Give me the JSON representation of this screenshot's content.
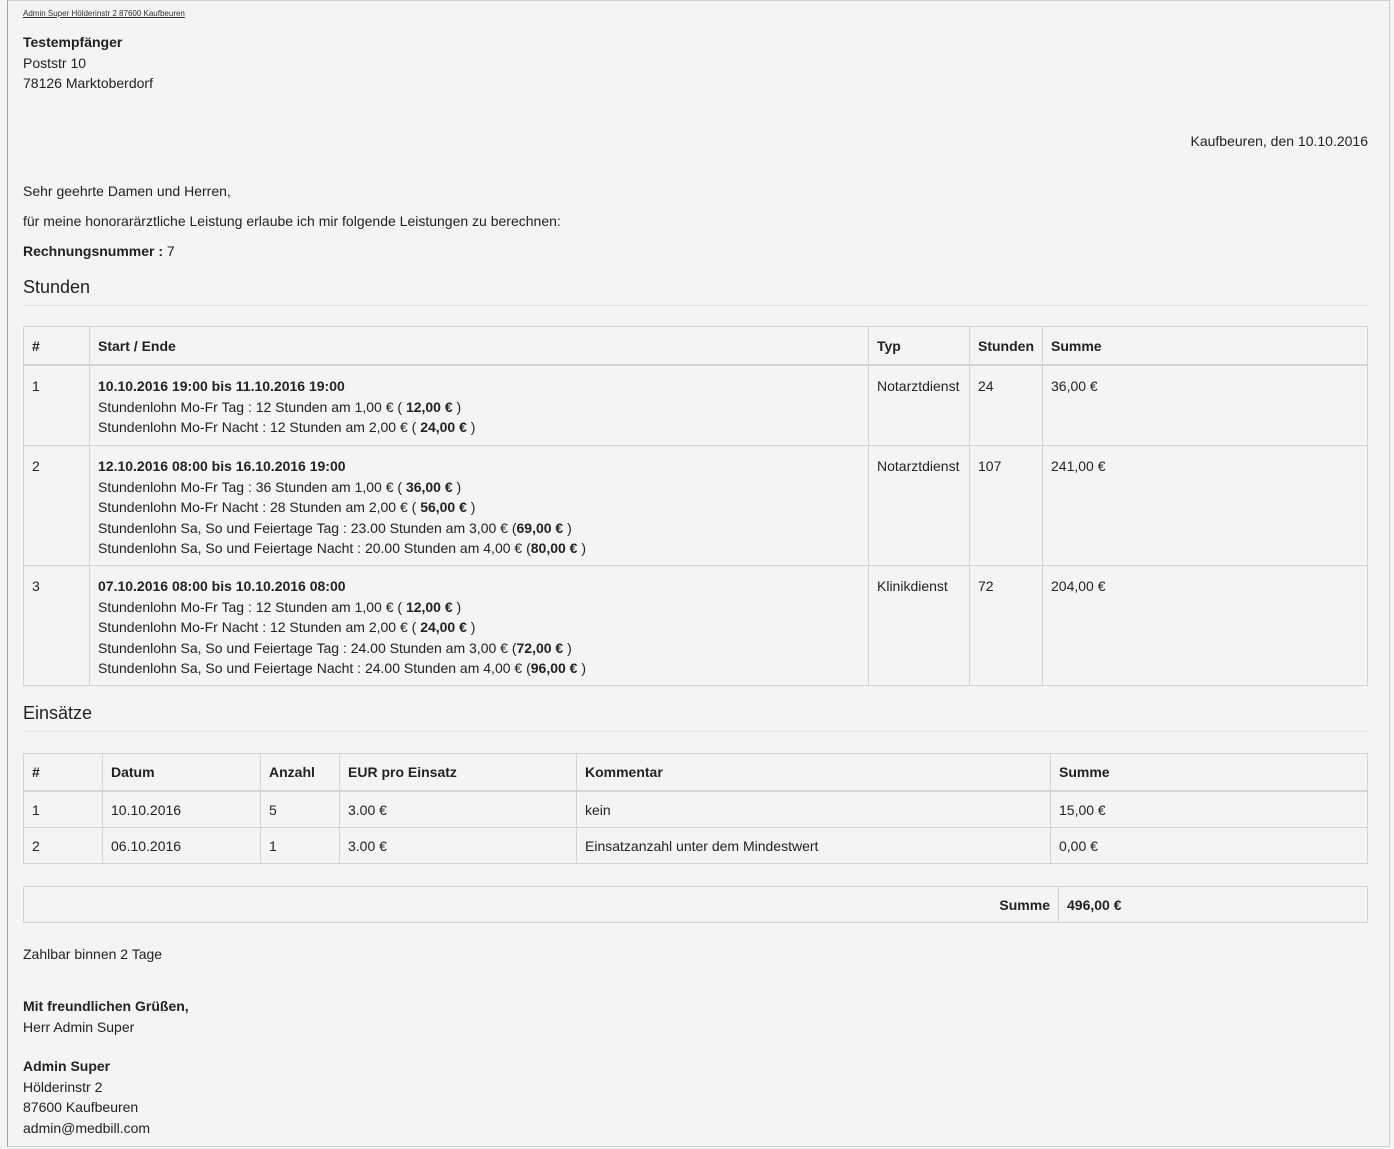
{
  "sender_line": "Admin Super Hölderinstr 2 87600 Kaufbeuren",
  "recipient": {
    "name": "Testempfänger",
    "street": "Poststr 10",
    "city": "78126 Marktoberdorf"
  },
  "date_line": "Kaufbeuren, den 10.10.2016",
  "salutation": "Sehr geehrte Damen und Herren,",
  "intro": "für meine honorarärztliche Leistung erlaube ich mir folgende Leistungen zu berechnen:",
  "invoice_number": {
    "label": "Rechnungsnummer :",
    "value": "7"
  },
  "stunden": {
    "heading": "Stunden",
    "headers": [
      "#",
      "Start / Ende",
      "Typ",
      "Stunden",
      "Summe"
    ],
    "rows": [
      {
        "num": "1",
        "period": "10.10.2016 19:00 bis 11.10.2016 19:00",
        "lines": [
          {
            "text": "Stundenlohn Mo-Fr Tag : 12 Stunden am 1,00 € ( ",
            "amount": "12,00 €",
            "close": " )"
          },
          {
            "text": "Stundenlohn Mo-Fr Nacht : 12 Stunden am 2,00 € ( ",
            "amount": "24,00 €",
            "close": " )"
          }
        ],
        "typ": "Notarztdienst",
        "stunden": "24",
        "summe": "36,00 €"
      },
      {
        "num": "2",
        "period": "12.10.2016 08:00 bis 16.10.2016 19:00",
        "lines": [
          {
            "text": "Stundenlohn Mo-Fr Tag : 36 Stunden am 1,00 € ( ",
            "amount": "36,00 €",
            "close": " )"
          },
          {
            "text": "Stundenlohn Mo-Fr Nacht : 28 Stunden am 2,00 € ( ",
            "amount": "56,00 €",
            "close": " )"
          },
          {
            "text": "Stundenlohn Sa, So und Feiertage Tag : 23.00 Stunden am 3,00 € (",
            "amount": "69,00 €",
            "close": " )"
          },
          {
            "text": "Stundenlohn Sa, So und Feiertage Nacht : 20.00 Stunden am 4,00 € (",
            "amount": "80,00 €",
            "close": " )"
          }
        ],
        "typ": "Notarztdienst",
        "stunden": "107",
        "summe": "241,00 €"
      },
      {
        "num": "3",
        "period": "07.10.2016 08:00 bis 10.10.2016 08:00",
        "lines": [
          {
            "text": "Stundenlohn Mo-Fr Tag : 12 Stunden am 1,00 € ( ",
            "amount": "12,00 €",
            "close": " )"
          },
          {
            "text": "Stundenlohn Mo-Fr Nacht : 12 Stunden am 2,00 € ( ",
            "amount": "24,00 €",
            "close": " )"
          },
          {
            "text": "Stundenlohn Sa, So und Feiertage Tag : 24.00 Stunden am 3,00 € (",
            "amount": "72,00 €",
            "close": " )"
          },
          {
            "text": "Stundenlohn Sa, So und Feiertage Nacht : 24.00 Stunden am 4,00 € (",
            "amount": "96,00 €",
            "close": " )"
          }
        ],
        "typ": "Klinikdienst",
        "stunden": "72",
        "summe": "204,00 €"
      }
    ]
  },
  "einsaetze": {
    "heading": "Einsätze",
    "headers": [
      "#",
      "Datum",
      "Anzahl",
      "EUR pro Einsatz",
      "Kommentar",
      "Summe"
    ],
    "rows": [
      {
        "num": "1",
        "datum": "10.10.2016",
        "anzahl": "5",
        "eur": "3.00 €",
        "kommentar": "kein",
        "summe": "15,00 €"
      },
      {
        "num": "2",
        "datum": "06.10.2016",
        "anzahl": "1",
        "eur": "3.00 €",
        "kommentar": "Einsatzanzahl unter dem Mindestwert",
        "summe": "0,00 €"
      }
    ]
  },
  "total": {
    "label": "Summe",
    "value": "496,00 €"
  },
  "payable": "Zahlbar binnen 2 Tage",
  "closing": {
    "greeting": "Mit freundlichen Grüßen,",
    "name": "Herr Admin Super"
  },
  "signer": {
    "name": "Admin Super",
    "street": "Hölderinstr 2",
    "city": "87600 Kaufbeuren",
    "email": "admin@medbill.com"
  }
}
